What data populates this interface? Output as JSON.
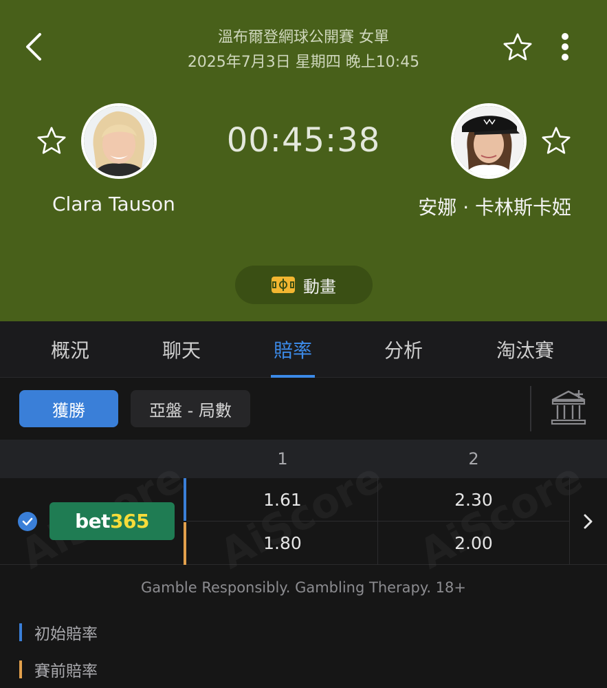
{
  "header": {
    "title": "溫布爾登網球公開賽 女單",
    "datetime": "2025年7月3日 星期四 晚上10:45",
    "timer": "00:45:38",
    "player1": {
      "name": "Clara Tauson"
    },
    "player2": {
      "name": "安娜 · 卡林斯卡婭"
    },
    "animation_label": "動畫"
  },
  "tabs": [
    {
      "label": "概況",
      "active": false
    },
    {
      "label": "聊天",
      "active": false
    },
    {
      "label": "賠率",
      "active": true
    },
    {
      "label": "分析",
      "active": false
    },
    {
      "label": "淘汰賽",
      "active": false
    }
  ],
  "filters": {
    "active": "獲勝",
    "inactive": "亞盤 - 局數"
  },
  "odds": {
    "columns": [
      "1",
      "2"
    ],
    "bookmaker": {
      "name_part1": "bet",
      "name_part2": "365"
    },
    "initial": [
      "1.61",
      "2.30"
    ],
    "pre_match": [
      "1.80",
      "2.00"
    ]
  },
  "watermark": "AiScore",
  "disclaimer": "Gamble Responsibly. Gambling Therapy. 18+",
  "legend": {
    "initial": "初始賠率",
    "pre_match": "賽前賠率"
  },
  "colors": {
    "header_bg": "#48601a",
    "accent_blue": "#3a7fd8",
    "initial_marker": "#3a7fd8",
    "pre_match_marker": "#e2a04c",
    "bookmaker_bg": "#1f7c53"
  }
}
